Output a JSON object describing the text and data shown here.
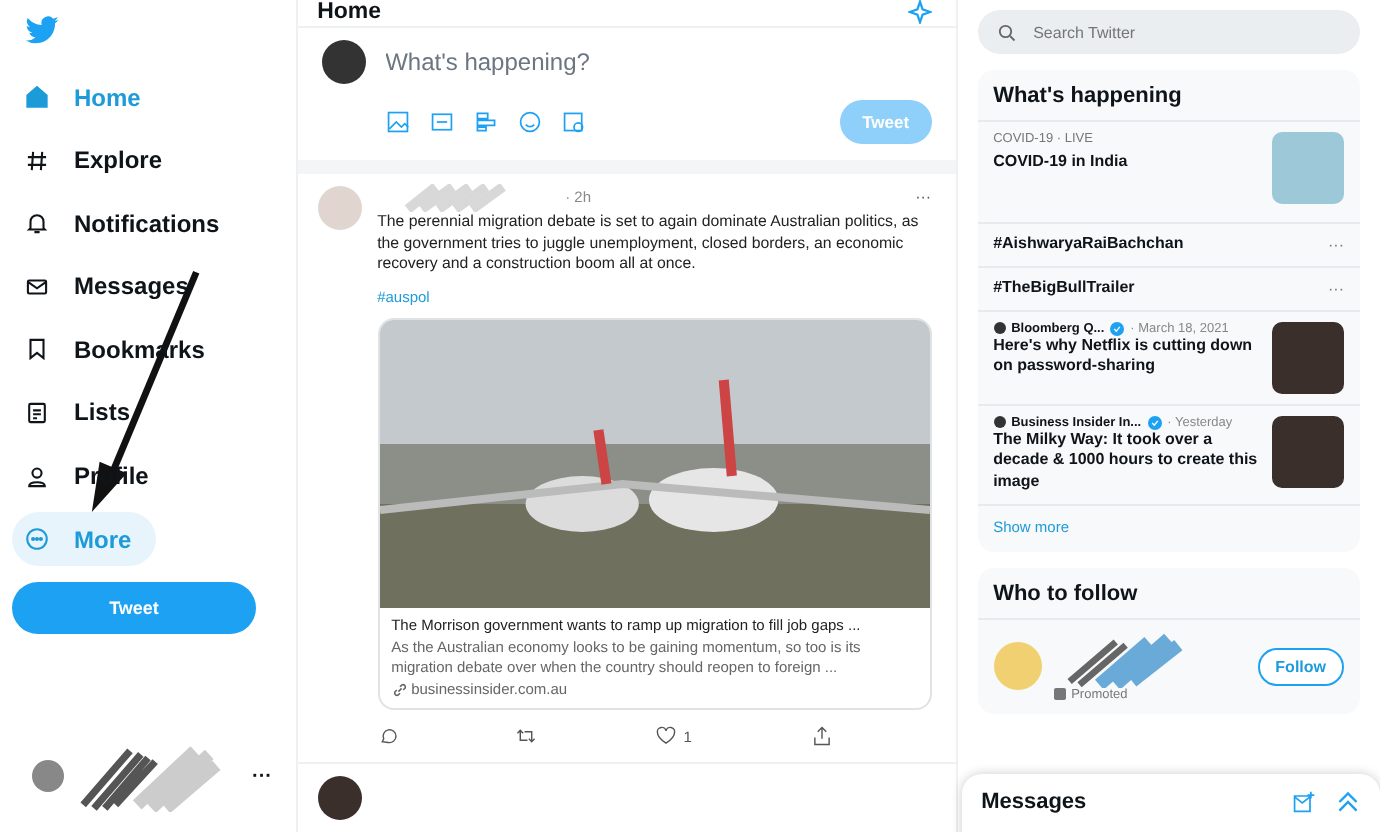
{
  "nav": {
    "items": [
      {
        "label": "Home",
        "selected": true,
        "highlighted": false
      },
      {
        "label": "Explore",
        "selected": false,
        "highlighted": false
      },
      {
        "label": "Notifications",
        "selected": false,
        "highlighted": false
      },
      {
        "label": "Messages",
        "selected": false,
        "highlighted": false
      },
      {
        "label": "Bookmarks",
        "selected": false,
        "highlighted": false
      },
      {
        "label": "Lists",
        "selected": false,
        "highlighted": false
      },
      {
        "label": "Profile",
        "selected": false,
        "highlighted": false
      },
      {
        "label": "More",
        "selected": false,
        "highlighted": true
      }
    ],
    "tweet_button": "Tweet",
    "account_more": "···"
  },
  "main": {
    "title": "Home",
    "compose": {
      "placeholder": "What's happening?",
      "button": "Tweet"
    },
    "tweet": {
      "time": "· 2h",
      "more": "···",
      "text": "The perennial migration debate is set to again dominate Australian politics, as the government tries to juggle unemployment, closed borders, an economic recovery and a construction boom all at once.",
      "hashtag": "#auspol",
      "card": {
        "title": "The Morrison government wants to ramp up migration to fill job gaps ...",
        "description": "As the Australian economy looks to be gaining momentum, so too is its migration debate over when the country should reopen to foreign ...",
        "domain": "businessinsider.com.au"
      },
      "like_count": "1"
    }
  },
  "sidebar": {
    "search": {
      "placeholder": "Search Twitter"
    },
    "trends": {
      "title": "What's happening",
      "items": [
        {
          "kind": "live",
          "context": "COVID-19 · LIVE",
          "headline": "COVID-19 in India"
        },
        {
          "kind": "hashtag",
          "headline": "#AishwaryaRaiBachchan",
          "more": "···"
        },
        {
          "kind": "hashtag",
          "headline": "#TheBigBullTrailer",
          "more": "···"
        },
        {
          "kind": "news",
          "source": "Bloomberg Q...",
          "time": "· March 18, 2021",
          "headline": "Here's why Netflix is cutting down on password-sharing"
        },
        {
          "kind": "news",
          "source": "Business Insider In...",
          "time": "· Yesterday",
          "headline": "The Milky Way: It took over a decade & 1000 hours to create this image"
        }
      ],
      "show_more": "Show more"
    },
    "who_to_follow": {
      "title": "Who to follow",
      "promoted": "Promoted",
      "button": "Follow"
    },
    "messages": {
      "title": "Messages"
    }
  }
}
